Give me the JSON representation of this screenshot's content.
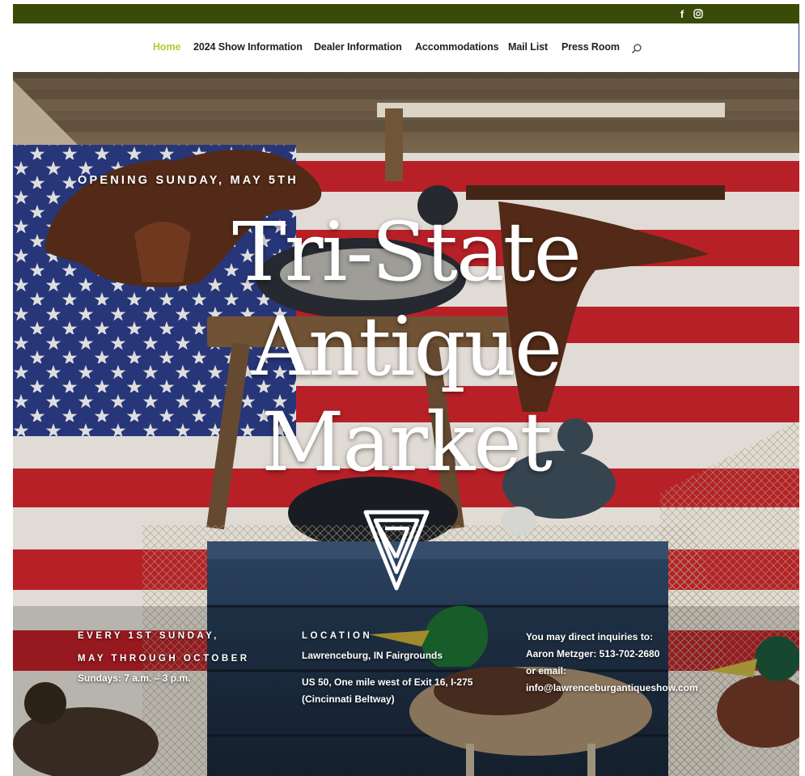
{
  "social": {
    "facebook_glyph": "f"
  },
  "nav": {
    "items": [
      {
        "label": "Home",
        "active": true
      },
      {
        "label": "2024 Show Information"
      },
      {
        "label": "Dealer Information"
      },
      {
        "label": "Accommodations"
      },
      {
        "label": "Mail List"
      },
      {
        "label": "Press Room"
      }
    ]
  },
  "hero": {
    "opening": "OPENING SUNDAY, MAY 5TH",
    "title_lines": [
      "Tri-State",
      "Antique",
      "Market"
    ]
  },
  "info": {
    "schedule": {
      "head1": "EVERY 1ST SUNDAY,",
      "head2": "MAY THROUGH OCTOBER",
      "hours": "Sundays: 7 a.m. – 3 p.m."
    },
    "location": {
      "head": "LOCATION",
      "place": "Lawrenceburg, IN Fairgrounds",
      "directions1": "US 50, One mile west of Exit 16, I-275",
      "directions2": "(Cincinnati Beltway)"
    },
    "contact": {
      "line1": "You may direct inquiries to:",
      "line2": "Aaron Metzger: 513-702-2680",
      "line3": "or email:",
      "email": "info@lawrenceburgantiqueshow.com"
    }
  },
  "colors": {
    "topbar": "#3a4a07",
    "nav_active": "#b9c932",
    "nav_text": "#222222",
    "flag_red": "#c8232b",
    "flag_blue": "#2b3b83"
  },
  "icons": [
    "facebook-icon",
    "instagram-icon",
    "search-icon",
    "tri-state-logo"
  ]
}
